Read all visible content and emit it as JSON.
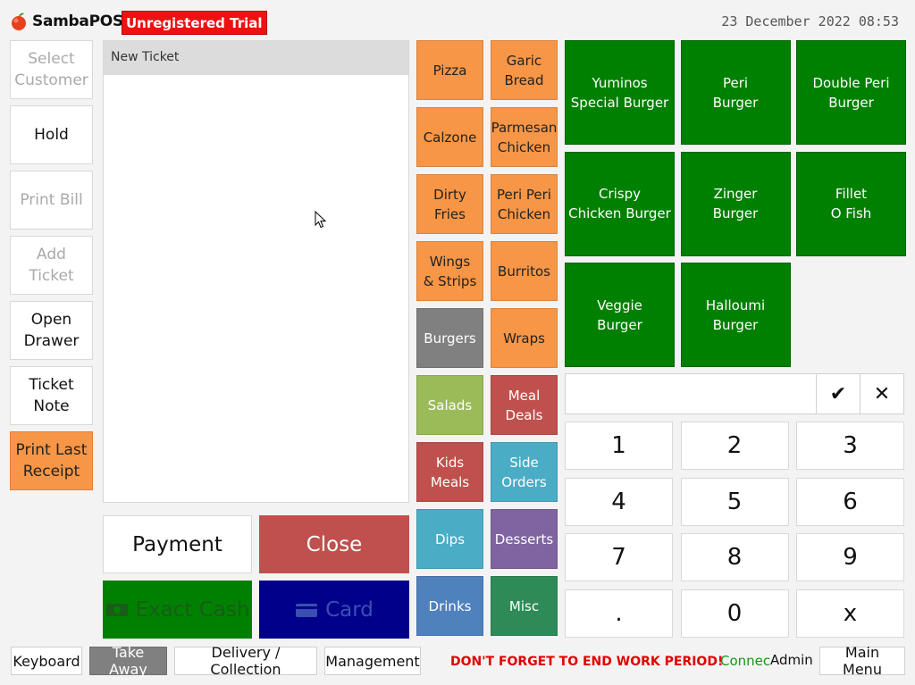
{
  "header": {
    "brand": "SambaPOS",
    "trial_badge": "Unregistered Trial",
    "datetime": "23 December 2022 08:53"
  },
  "left_buttons": {
    "select_customer": "Select\nCustomer",
    "hold": "Hold",
    "print_bill": "Print Bill",
    "add_ticket": "Add\nTicket",
    "open_drawer": "Open\nDrawer",
    "ticket_note": "Ticket\nNote",
    "print_last_receipt": "Print Last\nReceipt"
  },
  "ticket": {
    "title": "New Ticket"
  },
  "actions": {
    "payment": "Payment",
    "close": "Close",
    "exact_cash": "Exact Cash",
    "card": "Card"
  },
  "categories": [
    {
      "label": "Pizza",
      "color": "#f79646"
    },
    {
      "label": "Garic\nBread",
      "color": "#f79646"
    },
    {
      "label": "Calzone",
      "color": "#f79646"
    },
    {
      "label": "Parmesan\nChicken",
      "color": "#f79646"
    },
    {
      "label": "Dirty\nFries",
      "color": "#f79646"
    },
    {
      "label": "Peri Peri\nChicken",
      "color": "#f79646"
    },
    {
      "label": "Wings\n& Strips",
      "color": "#f79646"
    },
    {
      "label": "Burritos",
      "color": "#f79646"
    },
    {
      "label": "Burgers",
      "color": "#808080"
    },
    {
      "label": "Wraps",
      "color": "#f79646"
    },
    {
      "label": "Salads",
      "color": "#9bbb59"
    },
    {
      "label": "Meal\nDeals",
      "color": "#c0504d"
    },
    {
      "label": "Kids\nMeals",
      "color": "#c0504d"
    },
    {
      "label": "Side\nOrders",
      "color": "#4bacc6"
    },
    {
      "label": "Dips",
      "color": "#4bacc6"
    },
    {
      "label": "Desserts",
      "color": "#8064a2"
    },
    {
      "label": "Drinks",
      "color": "#4f81bd"
    },
    {
      "label": "Misc",
      "color": "#2e8b57"
    }
  ],
  "products": [
    "Yuminos\nSpecial Burger",
    "Peri\nBurger",
    "Double Peri\nBurger",
    "Crispy\nChicken Burger",
    "Zinger\nBurger",
    "Fillet\nO Fish",
    "Veggie\nBurger",
    "Halloumi\nBurger"
  ],
  "numpad": {
    "input_value": "",
    "confirm_symbol": "✔",
    "clear_symbol": "✕",
    "keys": [
      "1",
      "2",
      "3",
      "4",
      "5",
      "6",
      "7",
      "8",
      "9",
      ".",
      "0",
      "x"
    ]
  },
  "bottom_bar": {
    "keyboard": "Keyboard",
    "take_away": "Take Away",
    "delivery": "Delivery / Collection",
    "management": "Management",
    "warning": "DON'T FORGET TO END WORK PERIOD!",
    "connection": "Connected",
    "user": "Admin",
    "main_menu": "Main Menu"
  },
  "colors": {
    "product_green": "#008000",
    "accent_orange": "#f79646",
    "close_red": "#c0504d",
    "card_navy": "#00008b",
    "trial_red": "#ee1111"
  }
}
